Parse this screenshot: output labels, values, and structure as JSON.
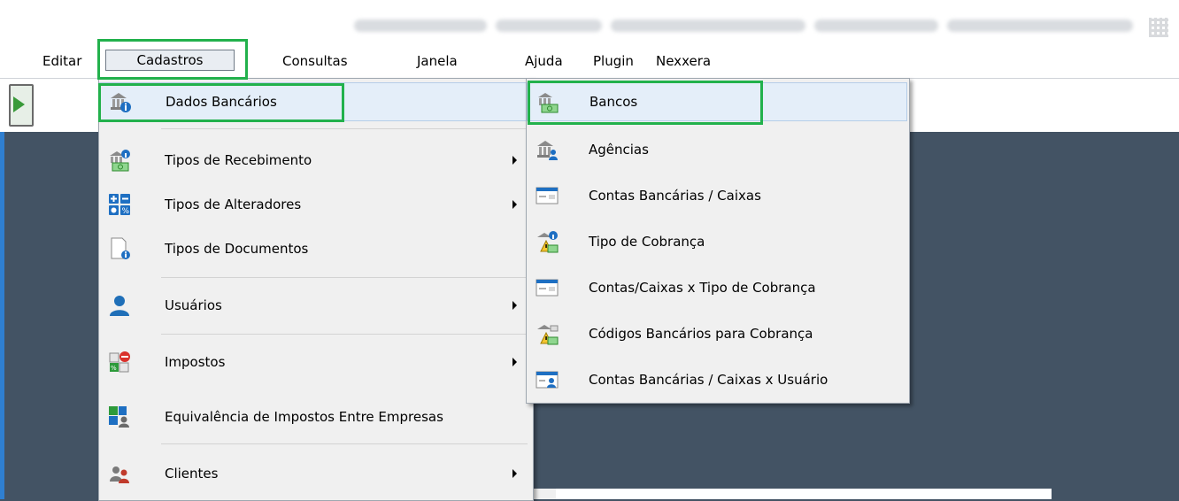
{
  "menubar": {
    "items": [
      "Editar",
      "Cadastros",
      "Consultas",
      "Janela",
      "Ajuda",
      "Plugin",
      "Nexxera"
    ]
  },
  "menu1": {
    "items": [
      {
        "label": "Dados Bancários",
        "icon": "bank-info-icon",
        "submenu": false,
        "highlighted": true
      },
      {
        "label": "Tipos de Recebimento",
        "icon": "money-receive-icon",
        "submenu": true
      },
      {
        "label": "Tipos de Alteradores",
        "icon": "calc-operators-icon",
        "submenu": true
      },
      {
        "label": "Tipos de Documentos",
        "icon": "document-info-icon",
        "submenu": false
      },
      {
        "label": "Usuários",
        "icon": "user-icon",
        "submenu": true
      },
      {
        "label": "Impostos",
        "icon": "tax-icon",
        "submenu": true
      },
      {
        "label": "Equivalência de Impostos Entre Empresas",
        "icon": "tax-equivalence-icon",
        "submenu": false
      },
      {
        "label": "Clientes",
        "icon": "clients-icon",
        "submenu": true
      }
    ]
  },
  "menu2": {
    "items": [
      {
        "label": "Bancos",
        "icon": "bank-money-icon",
        "highlighted": true
      },
      {
        "label": "Agências",
        "icon": "bank-agency-icon"
      },
      {
        "label": "Contas Bancárias / Caixas",
        "icon": "bank-account-icon"
      },
      {
        "label": "Tipo de Cobrança",
        "icon": "billing-type-icon"
      },
      {
        "label": "Contas/Caixas x Tipo de Cobrança",
        "icon": "account-billing-icon"
      },
      {
        "label": "Códigos Bancários para Cobrança",
        "icon": "bank-codes-icon"
      },
      {
        "label": "Contas Bancárias / Caixas x Usuário",
        "icon": "account-user-icon"
      }
    ]
  },
  "colors": {
    "desktop": "#435364",
    "highlight_box": "#22b14c",
    "menu_bg": "#f0f0f0"
  }
}
